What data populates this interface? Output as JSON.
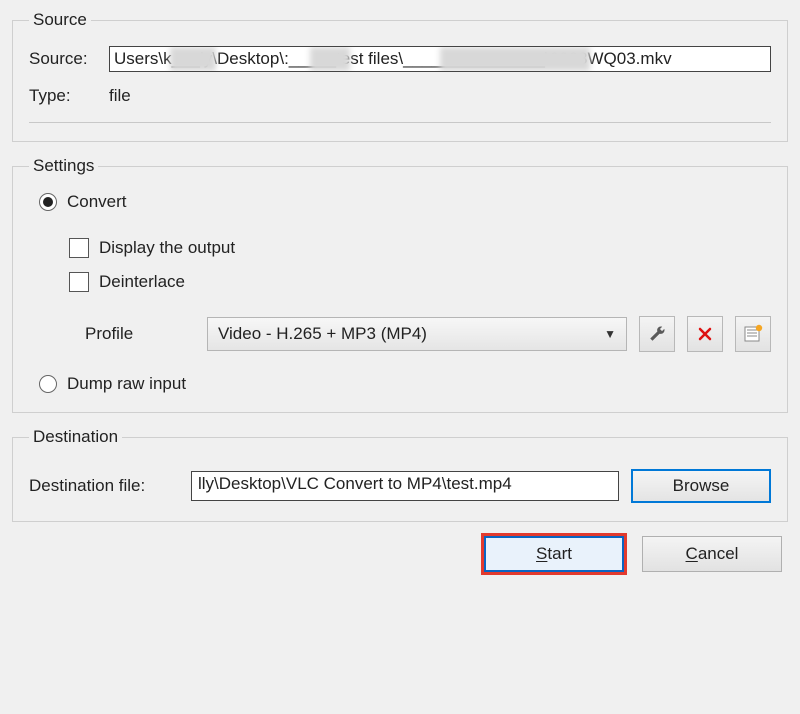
{
  "source": {
    "legend": "Source",
    "label": "Source:",
    "path_display": "Users\\k___ly\\Desktop\\:_____test files\\_______________\\0028WQ03.mkv",
    "type_label": "Type:",
    "type_value": "file"
  },
  "settings": {
    "legend": "Settings",
    "convert": {
      "label": "Convert",
      "selected": true,
      "display_output": {
        "label": "Display the output",
        "checked": false
      },
      "deinterlace": {
        "label": "Deinterlace",
        "checked": false
      },
      "profile_label": "Profile",
      "profile_value": "Video - H.265 + MP3 (MP4)",
      "icons": {
        "edit": "wrench-icon",
        "delete": "x-icon",
        "new": "new-profile-icon"
      }
    },
    "dump": {
      "label": "Dump raw input",
      "selected": false
    }
  },
  "destination": {
    "legend": "Destination",
    "label": "Destination file:",
    "value": "lly\\Desktop\\VLC Convert to MP4\\test.mp4",
    "browse": "Browse"
  },
  "actions": {
    "start": "Start",
    "cancel": "Cancel"
  }
}
